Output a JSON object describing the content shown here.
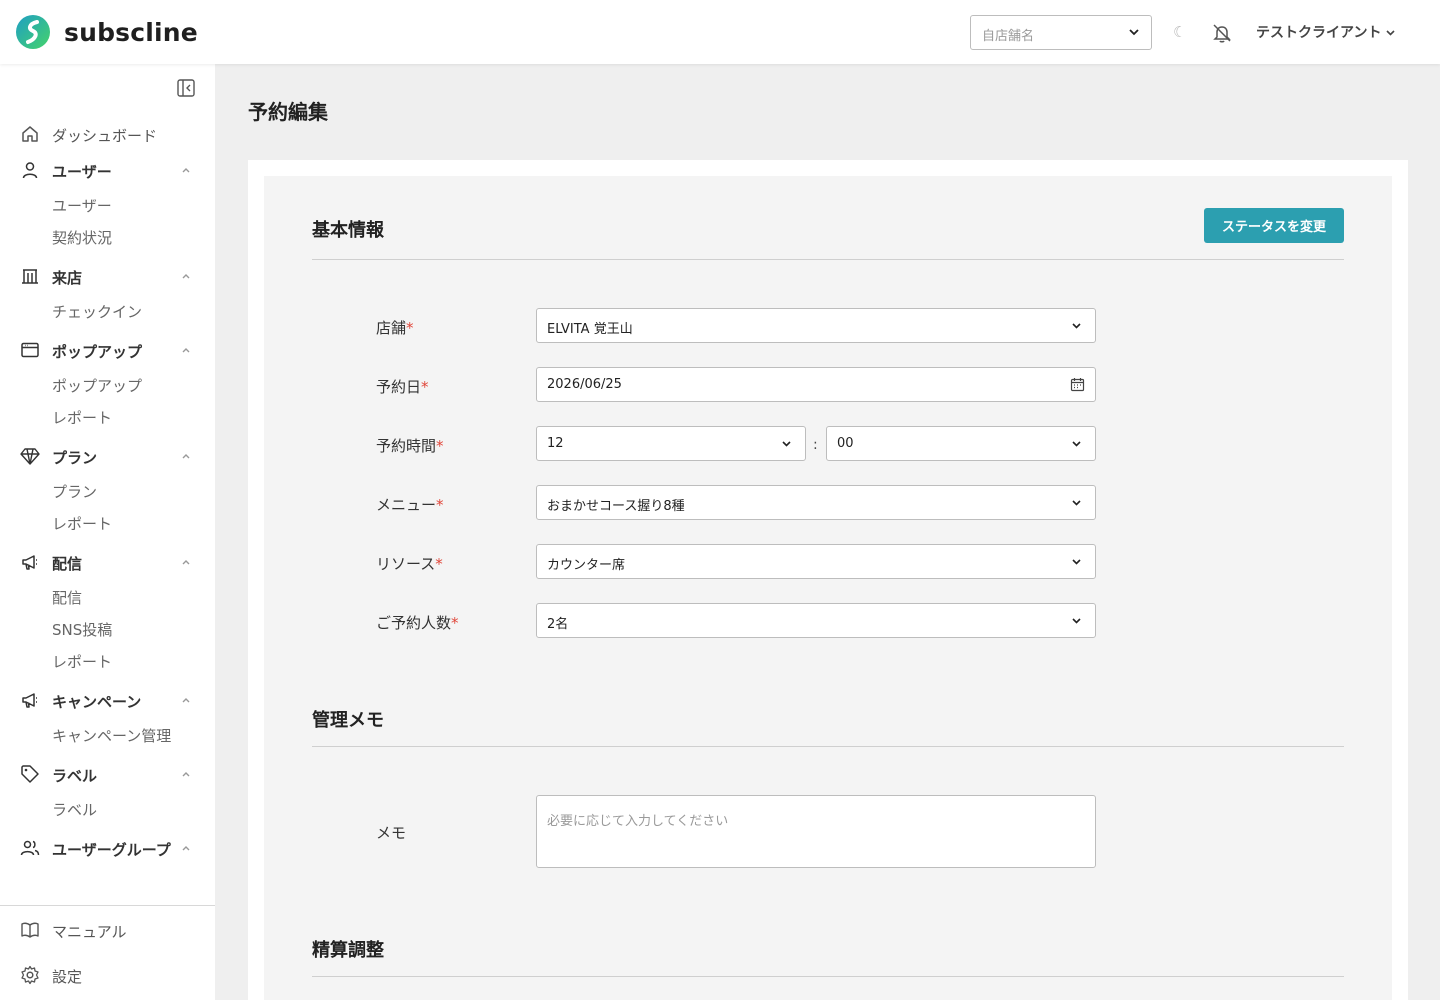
{
  "header": {
    "brand": "subscline",
    "store_placeholder": "自店舗名",
    "theme_toggle": "☾",
    "user_name": "テストクライアント"
  },
  "sidebar": {
    "items": [
      {
        "kind": "plain",
        "label": "ダッシュボード",
        "icon": "home-icon"
      },
      {
        "kind": "parent",
        "label": "ユーザー",
        "icon": "user-icon",
        "children": [
          "ユーザー",
          "契約状況"
        ]
      },
      {
        "kind": "parent",
        "label": "来店",
        "icon": "building-icon",
        "children": [
          "チェックイン"
        ]
      },
      {
        "kind": "parent",
        "label": "ポップアップ",
        "icon": "window-icon",
        "children": [
          "ポップアップ",
          "レポート"
        ]
      },
      {
        "kind": "parent",
        "label": "プラン",
        "icon": "diamond-icon",
        "children": [
          "プラン",
          "レポート"
        ]
      },
      {
        "kind": "parent",
        "label": "配信",
        "icon": "megaphone-icon",
        "children": [
          "配信",
          "SNS投稿",
          "レポート"
        ]
      },
      {
        "kind": "parent",
        "label": "キャンペーン",
        "icon": "megaphone-icon",
        "children": [
          "キャンペーン管理"
        ]
      },
      {
        "kind": "parent",
        "label": "ラベル",
        "icon": "tag-icon",
        "children": [
          "ラベル"
        ]
      },
      {
        "kind": "parent",
        "label": "ユーザーグループ",
        "icon": "users-icon",
        "children": []
      }
    ],
    "bottom": [
      {
        "label": "マニュアル",
        "icon": "book-icon"
      },
      {
        "label": "設定",
        "icon": "gear-icon"
      }
    ]
  },
  "main": {
    "page_title": "予約編集",
    "basic_section": {
      "title": "基本情報",
      "status_button": "ステータスを変更",
      "fields": {
        "store": {
          "label": "店舗",
          "value": "ELVITA 覚王山"
        },
        "date": {
          "label": "予約日",
          "value": "2026/06/25"
        },
        "time": {
          "label": "予約時間",
          "hour": "12",
          "minute": "00",
          "separator": ":"
        },
        "menu": {
          "label": "メニュー",
          "value": "おまかせコース握り8種"
        },
        "resource": {
          "label": "リソース",
          "value": "カウンター席"
        },
        "party": {
          "label": "ご予約人数",
          "value": "2名"
        }
      },
      "required_mark": "*"
    },
    "memo_section": {
      "title": "管理メモ",
      "label": "メモ",
      "placeholder": "必要に応じて入力してください"
    },
    "settlement_section": {
      "title": "精算調整"
    }
  },
  "colors": {
    "accent": "#2c9fb0",
    "required": "#e0473a",
    "brand_teal": "#2bb3a3",
    "brand_green": "#3cc46a"
  }
}
